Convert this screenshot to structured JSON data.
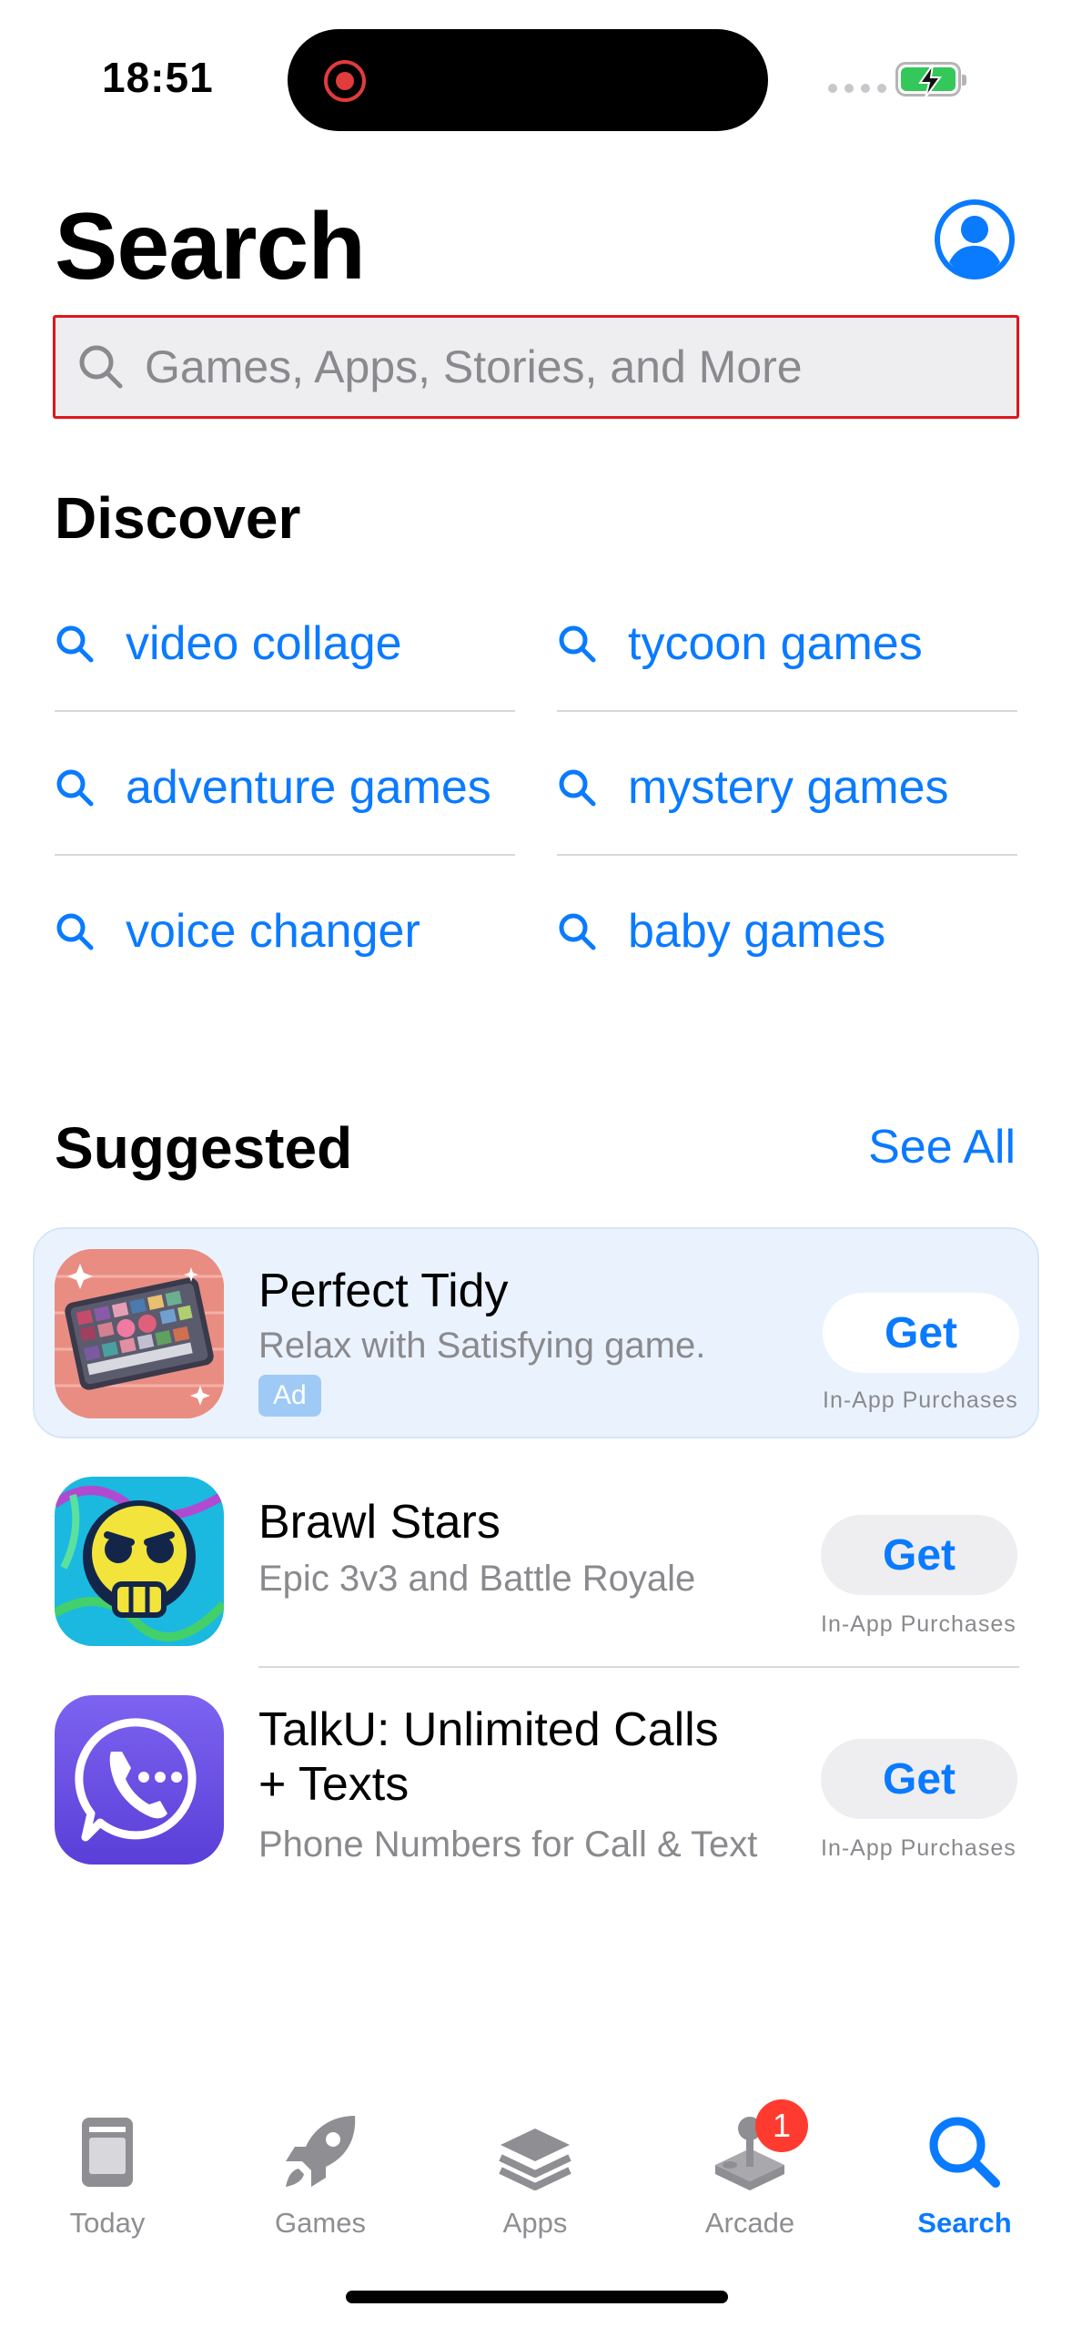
{
  "status_bar": {
    "time": "18:51"
  },
  "header": {
    "title": "Search"
  },
  "search": {
    "placeholder": "Games, Apps, Stories, and More"
  },
  "discover": {
    "title": "Discover",
    "items": [
      {
        "label": "video collage"
      },
      {
        "label": "tycoon games"
      },
      {
        "label": "adventure games"
      },
      {
        "label": "mystery games"
      },
      {
        "label": "voice changer"
      },
      {
        "label": "baby games"
      }
    ]
  },
  "suggested": {
    "title": "Suggested",
    "see_all": "See All",
    "apps": [
      {
        "name": "Perfect Tidy",
        "subtitle": "Relax with Satisfying game.",
        "badge": "Ad",
        "button": "Get",
        "note": "In-App Purchases",
        "icon": "makeup-palette-icon"
      },
      {
        "name": "Brawl Stars",
        "subtitle": "Epic 3v3 and Battle Royale",
        "button": "Get",
        "note": "In-App Purchases",
        "icon": "skull-icon"
      },
      {
        "name_line1": "TalkU: Unlimited Calls",
        "name_line2": "+ Texts",
        "subtitle": "Phone Numbers for Call & Text",
        "button": "Get",
        "note": "In-App Purchases",
        "icon": "phone-bubble-icon"
      }
    ]
  },
  "tab_bar": {
    "tabs": [
      {
        "label": "Today",
        "icon": "today-icon"
      },
      {
        "label": "Games",
        "icon": "rocket-icon"
      },
      {
        "label": "Apps",
        "icon": "stack-icon"
      },
      {
        "label": "Arcade",
        "icon": "joystick-icon",
        "badge": "1"
      },
      {
        "label": "Search",
        "icon": "search-icon",
        "active": true
      }
    ]
  },
  "colors": {
    "accent": "#0a7aff",
    "ad_background": "#eaf3fd",
    "badge": "#ff3b30",
    "highlight_border": "#e0161c"
  }
}
